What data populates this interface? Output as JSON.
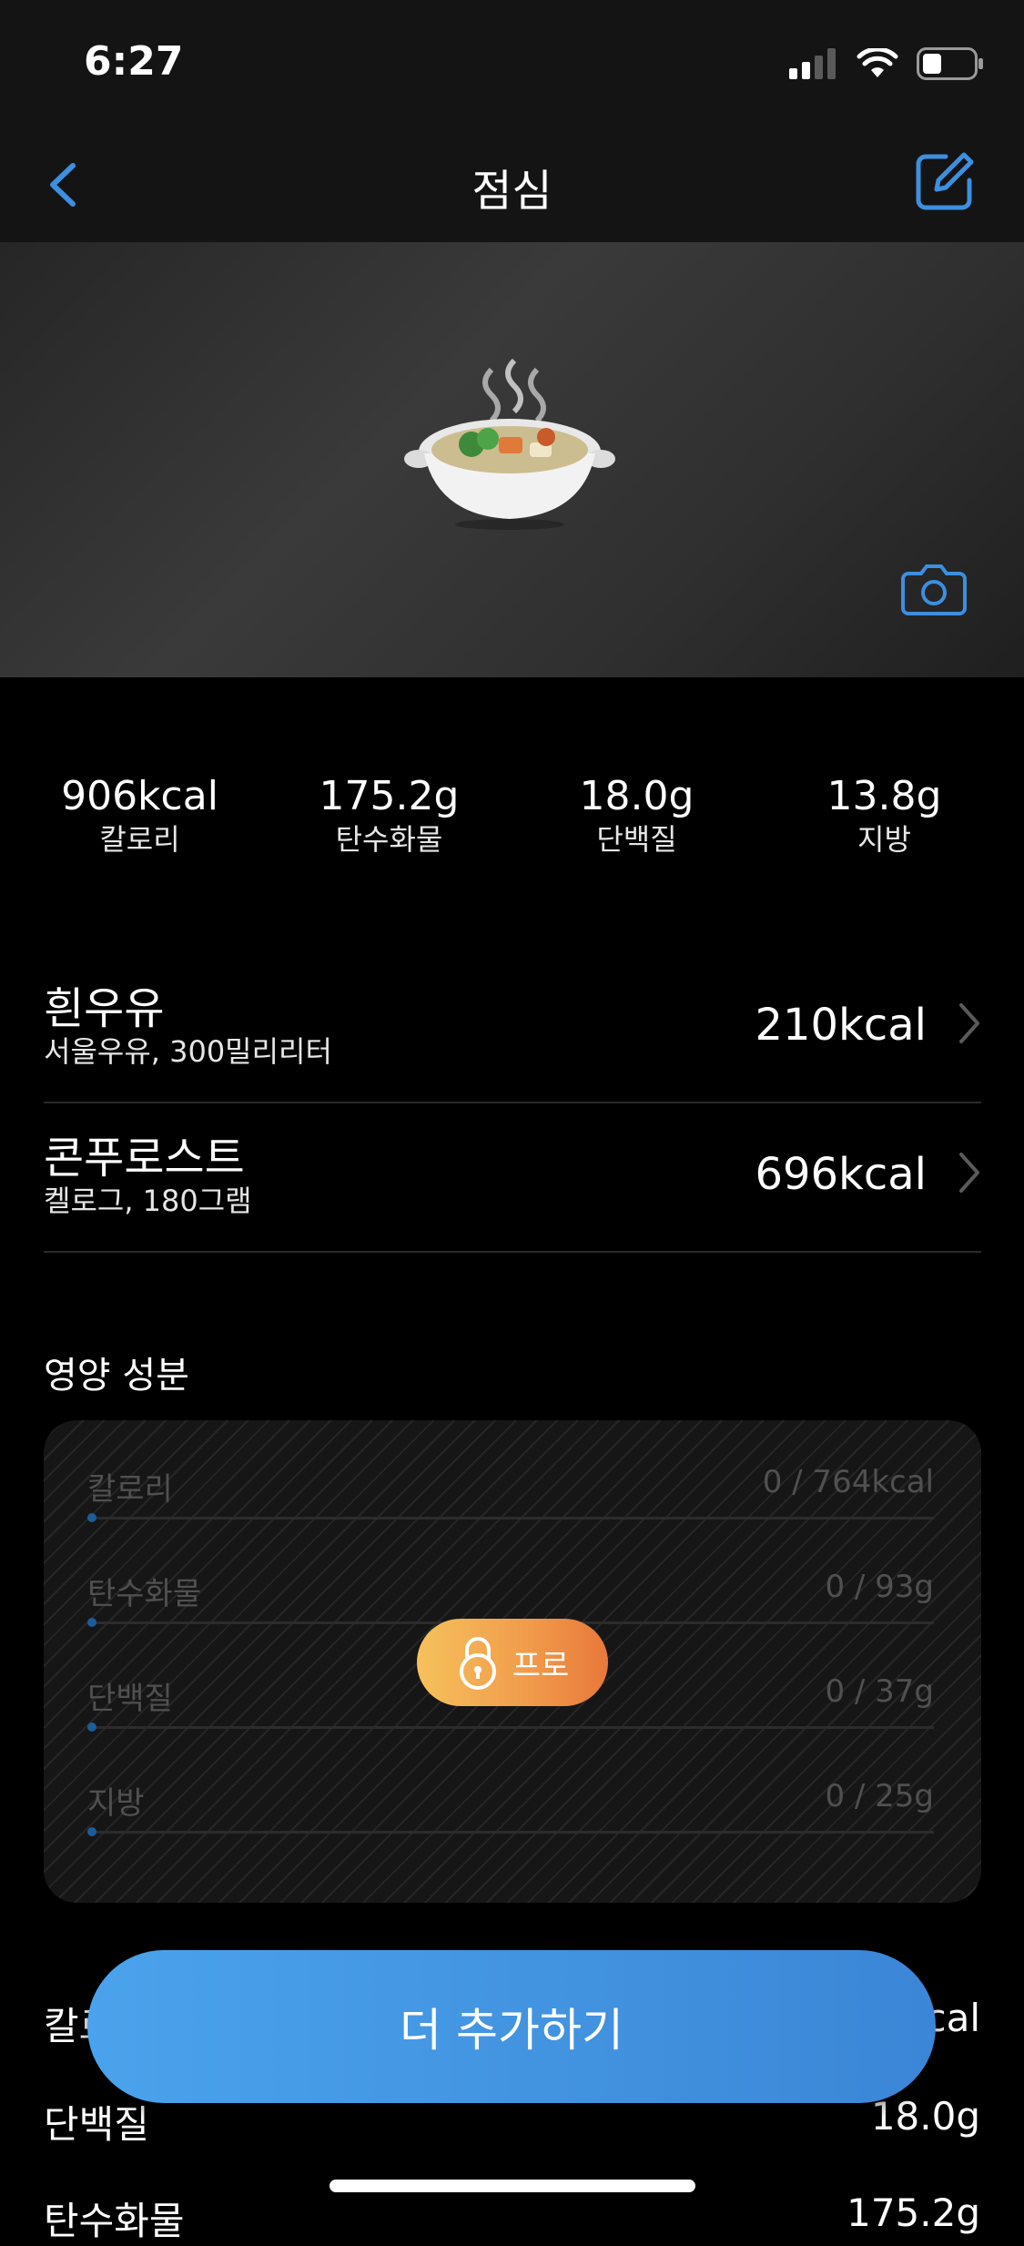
{
  "status_bar": {
    "time": "6:27"
  },
  "nav": {
    "title": "점심"
  },
  "summary": [
    {
      "value": "906kcal",
      "label": "칼로리"
    },
    {
      "value": "175.2g",
      "label": "탄수화물"
    },
    {
      "value": "18.0g",
      "label": "단백질"
    },
    {
      "value": "13.8g",
      "label": "지방"
    }
  ],
  "foods": [
    {
      "name": "흰우유",
      "detail": "서울우유, 300밀리리터",
      "kcal": "210kcal"
    },
    {
      "name": "콘푸로스트",
      "detail": "켈로그, 180그램",
      "kcal": "696kcal"
    }
  ],
  "nutrition": {
    "heading": "영양 성분",
    "rows": [
      {
        "label": "칼로리",
        "value": "0 / 764kcal"
      },
      {
        "label": "탄수화물",
        "value": "0 / 93g"
      },
      {
        "label": "단백질",
        "value": "0 / 37g"
      },
      {
        "label": "지방",
        "value": "0 / 25g"
      }
    ],
    "pro_label": "프로"
  },
  "totals": [
    {
      "label": "칼로리",
      "value": "906kcal"
    },
    {
      "label": "단백질",
      "value": "18.0g"
    },
    {
      "label": "탄수화물",
      "value": "175.2g"
    }
  ],
  "add_more_label": "더 추가하기",
  "colors": {
    "accent": "#3d8fe0",
    "pro_start": "#f6c15c",
    "pro_end": "#e8783a"
  },
  "icons": [
    "back-chevron-icon",
    "edit-icon",
    "hotpot-icon",
    "camera-icon",
    "chevron-right-icon",
    "lock-icon"
  ]
}
